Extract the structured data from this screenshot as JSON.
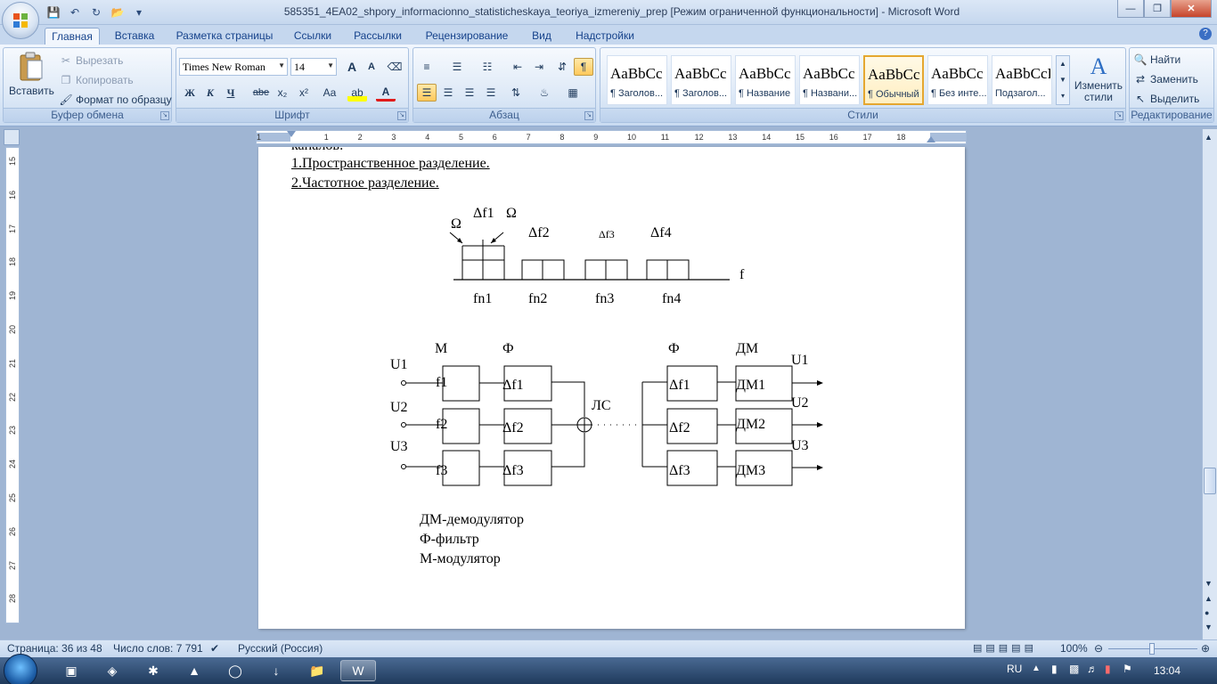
{
  "window": {
    "title": "585351_4EA02_shpory_informacionno_statisticheskaya_teoriya_izmereniy_prep [Режим ограниченной функциональности] - Microsoft Word"
  },
  "tabs": [
    "Главная",
    "Вставка",
    "Разметка страницы",
    "Ссылки",
    "Рассылки",
    "Рецензирование",
    "Вид",
    "Надстройки"
  ],
  "ribbon": {
    "clipboard": {
      "label": "Буфер обмена",
      "paste": "Вставить",
      "cut": "Вырезать",
      "copy": "Копировать",
      "format_painter": "Формат по образцу"
    },
    "font": {
      "label": "Шрифт",
      "font_name": "Times New Roman",
      "font_size": "14",
      "bold": "Ж",
      "italic": "К",
      "underline": "Ч",
      "strike": "abe",
      "sub": "x₂",
      "sup": "x²",
      "case": "Aa",
      "highlight": "ab",
      "color": "A",
      "grow": "A",
      "shrink": "A"
    },
    "paragraph": {
      "label": "Абзац"
    },
    "styles": {
      "label": "Стили",
      "sample": "AaBbCcI",
      "items": [
        {
          "sample": "AaBbCc",
          "name": "¶ Заголов..."
        },
        {
          "sample": "AaBbCc",
          "name": "¶ Заголов..."
        },
        {
          "sample": "AaBbCc",
          "name": "¶ Название"
        },
        {
          "sample": "AaBbCc",
          "name": "¶ Названи..."
        },
        {
          "sample": "AaBbCc",
          "name": "¶ Обычный"
        },
        {
          "sample": "AaBbCc",
          "name": "¶ Без инте..."
        },
        {
          "sample": "AaBbCcI",
          "name": "Подзагол..."
        }
      ],
      "change_styles": "Изменить стили"
    },
    "editing": {
      "label": "Редактирование",
      "find": "Найти",
      "replace": "Заменить",
      "select": "Выделить"
    }
  },
  "ruler": {
    "h_numbers": [
      "1",
      "1",
      "2",
      "3",
      "4",
      "5",
      "6",
      "7",
      "8",
      "9",
      "10",
      "11",
      "12",
      "13",
      "14",
      "15",
      "16",
      "17",
      "18"
    ],
    "v_numbers": [
      "15",
      "16",
      "17",
      "18",
      "19",
      "20",
      "21",
      "22",
      "23",
      "24",
      "25",
      "26",
      "27",
      "28"
    ]
  },
  "document": {
    "cut_line": "каналов:",
    "line1": "1.Пространственное разделение.",
    "line2": "2.Частотное разделение.",
    "spectrum": {
      "omega_left": "Ω",
      "df1": "Δf1",
      "omega_right": "Ω",
      "df2": "Δf2",
      "df3": "Δf3",
      "df4": "Δf4",
      "f": "f",
      "fn1": "fn1",
      "fn2": "fn2",
      "fn3": "fn3",
      "fn4": "fn4"
    },
    "block": {
      "m": "М",
      "phi_left": "Ф",
      "phi_right": "Ф",
      "dm": "ДМ",
      "u1": "U1",
      "u2": "U2",
      "u3": "U3",
      "f1": "f1",
      "f2": "f2",
      "f3": "f3",
      "df1": "Δf1",
      "df2": "Δf2",
      "df3": "Δf3",
      "ls": "ЛС",
      "rdf1": "Δf1",
      "rdf2": "Δf2",
      "rdf3": "Δf3",
      "dm1": "ДМ1",
      "dm2": "ДМ2",
      "dm3": "ДМ3",
      "out_u1": "U1",
      "out_u2": "U2",
      "out_u3": "U3"
    },
    "legend": [
      "ДМ-демодулятор",
      "Ф-фильтр",
      "М-модулятор"
    ]
  },
  "status": {
    "page": "Страница: 36 из 48",
    "words": "Число слов: 7 791",
    "language": "Русский (Россия)",
    "zoom": "100%"
  },
  "tray": {
    "lang": "RU",
    "time": "13:04"
  }
}
